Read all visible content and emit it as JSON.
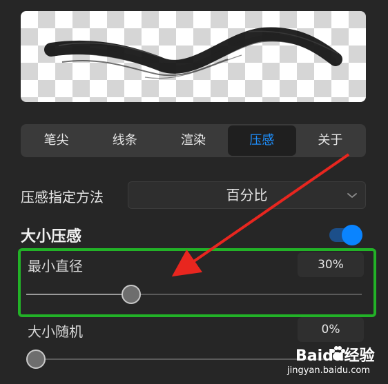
{
  "tabs": [
    {
      "label": "笔尖",
      "active": false
    },
    {
      "label": "线条",
      "active": false
    },
    {
      "label": "渲染",
      "active": false
    },
    {
      "label": "压感",
      "active": true
    },
    {
      "label": "关于",
      "active": false
    }
  ],
  "pressure_method": {
    "label": "压感指定方法",
    "value": "百分比"
  },
  "size_pressure": {
    "title": "大小压感",
    "toggle_on": true
  },
  "min_diameter": {
    "label": "最小直径",
    "value": "30%",
    "level": 0.31
  },
  "size_random": {
    "label": "大小随机",
    "value": "0%",
    "level": 0
  },
  "watermark": {
    "brand": "Baidu经验",
    "url": "jingyan.baidu.com"
  },
  "colors": {
    "accent": "#0a84ff",
    "highlight_box": "#22b227",
    "annotation_arrow": "#e8261f"
  },
  "icons": {
    "dropdown": "chevron-down-icon",
    "watermark_logo": "paw-icon"
  }
}
